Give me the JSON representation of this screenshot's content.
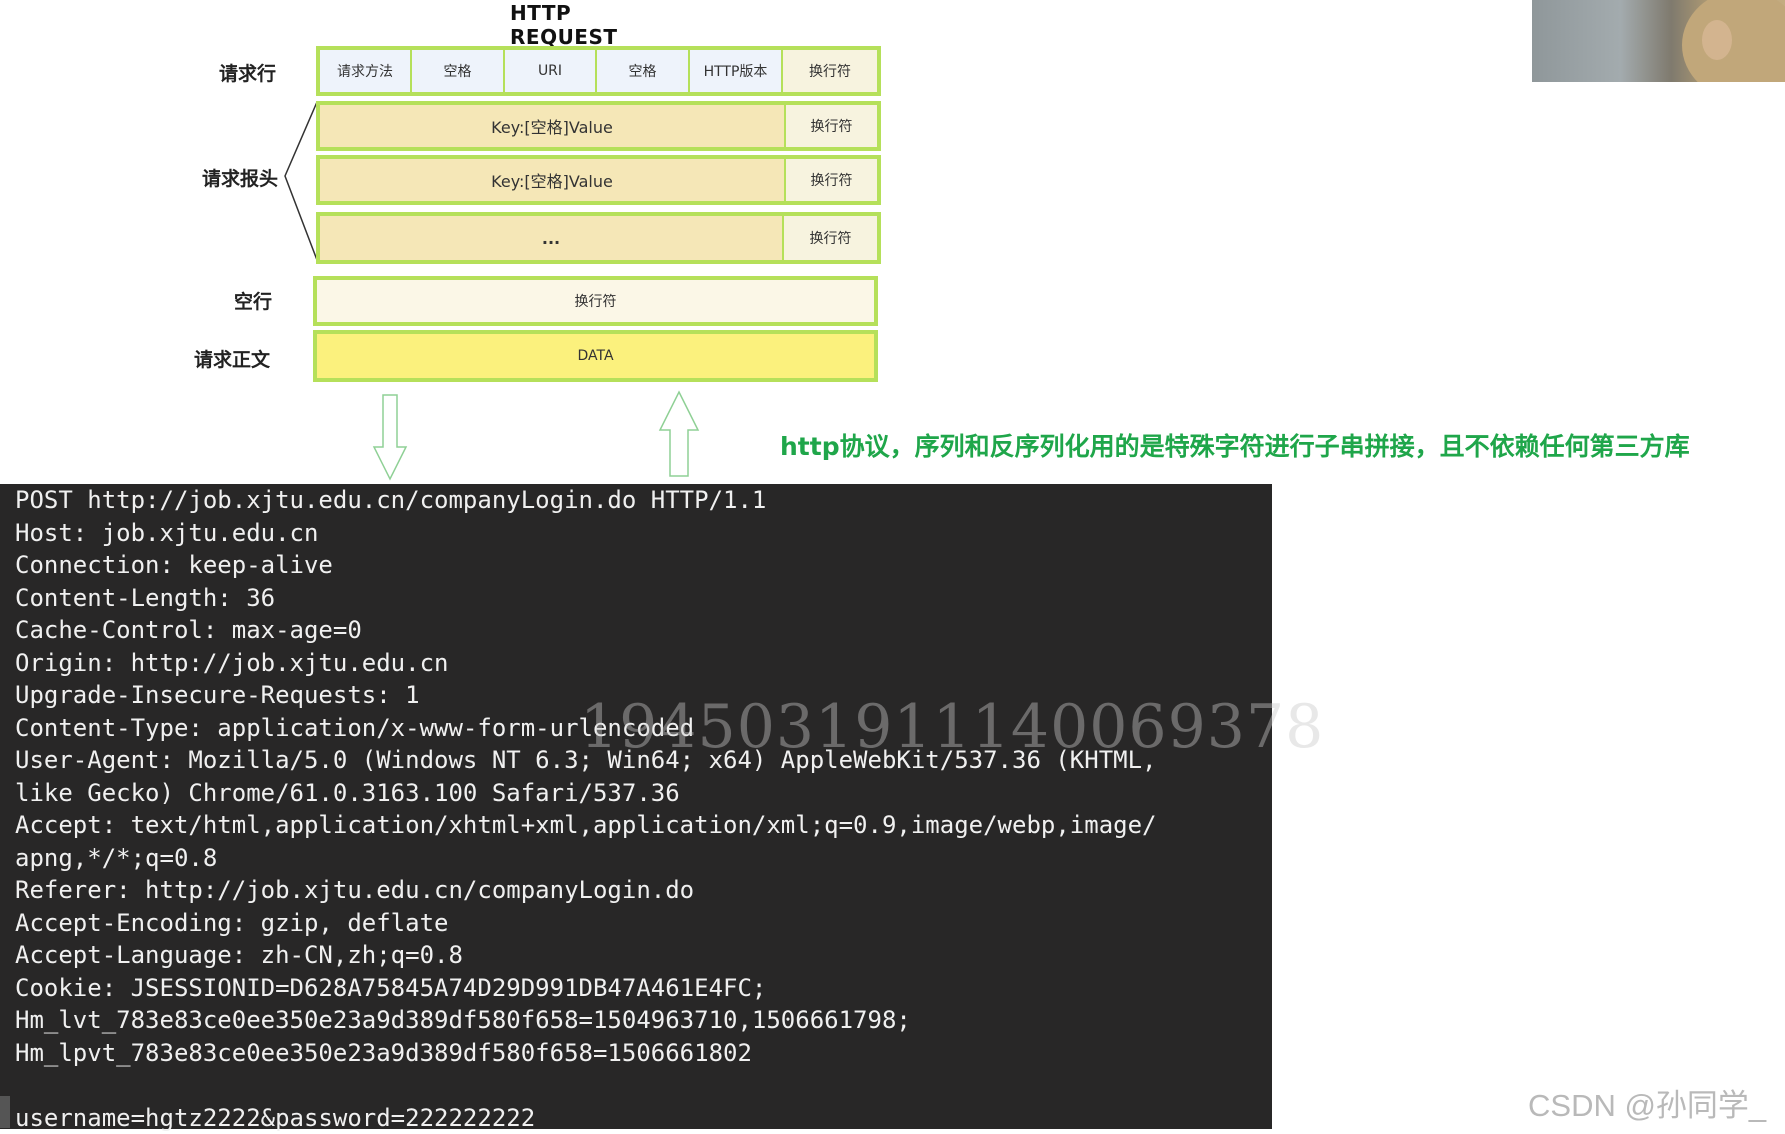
{
  "diagram": {
    "title": "HTTP REQUEST",
    "labels": {
      "request_line": "请求行",
      "request_headers": "请求报头",
      "blank_line": "空行",
      "request_body": "请求正文"
    },
    "request_line_cells": [
      "请求方法",
      "空格",
      "URI",
      "空格",
      "HTTP版本",
      "换行符"
    ],
    "header_rows": [
      {
        "content": "Key:[空格]Value",
        "end": "换行符"
      },
      {
        "content": "Key:[空格]Value",
        "end": "换行符"
      },
      {
        "content": "...",
        "end": "换行符"
      }
    ],
    "blank_line_cell": "换行符",
    "body_cell": "DATA"
  },
  "annotation": "http协议，序列和反序列化用的是特殊字符进行子串拼接，且不依赖任何第三方库",
  "terminal": {
    "lines": [
      "POST http://job.xjtu.edu.cn/companyLogin.do HTTP/1.1",
      "Host: job.xjtu.edu.cn",
      "Connection: keep-alive",
      "Content-Length: 36",
      "Cache-Control: max-age=0",
      "Origin: http://job.xjtu.edu.cn",
      "Upgrade-Insecure-Requests: 1",
      "Content-Type: application/x-www-form-urlencoded",
      "User-Agent: Mozilla/5.0 (Windows NT 6.3; Win64; x64) AppleWebKit/537.36 (KHTML,",
      "like Gecko) Chrome/61.0.3163.100 Safari/537.36",
      "Accept: text/html,application/xhtml+xml,application/xml;q=0.9,image/webp,image/",
      "apng,*/*;q=0.8",
      "Referer: http://job.xjtu.edu.cn/companyLogin.do",
      "Accept-Encoding: gzip, deflate",
      "Accept-Language: zh-CN,zh;q=0.8",
      "Cookie: JSESSIONID=D628A75845A74D29D991DB47A461E4FC;",
      "Hm_lvt_783e83ce0ee350e23a9d389df580f658=1504963710,1506661798;",
      "Hm_lpvt_783e83ce0ee350e23a9d389df580f658=1506661802",
      "",
      "username=hgtz2222&password=222222222"
    ]
  },
  "watermarks": {
    "overlay_number": "19450319111400693​78",
    "csdn": "CSDN @孙同学_"
  }
}
